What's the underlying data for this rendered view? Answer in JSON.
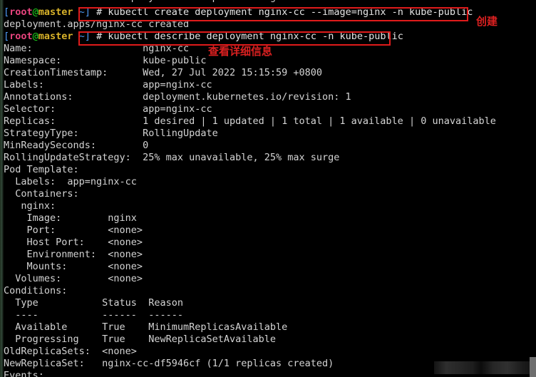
{
  "terminal": {
    "title": "root@master:~",
    "colors": {
      "background": "#000000",
      "foreground": "#d4d4d4",
      "prompt_bracket": "#4d9bf5",
      "prompt_user": "#e8447e",
      "prompt_at": "#1ee11e",
      "prompt_host": "#d8b22a",
      "annotation_red": "#d92020",
      "box_red": "#e01b1b"
    },
    "prompt": {
      "open_bracket": "[",
      "user": "root",
      "at": "@",
      "host": "master",
      "path_close": " ~]",
      "sigil": "#"
    },
    "lines": [
      {
        "type": "output",
        "text": "See 'kubectl create deployment --help' for usage."
      },
      {
        "type": "command",
        "text": "kubectl create deployment nginx-cc --image=nginx -n kube-public"
      },
      {
        "type": "output",
        "text": "deployment.apps/nginx-cc created"
      },
      {
        "type": "command",
        "text": "kubectl describe deployment nginx-cc -n kube-public"
      },
      {
        "type": "output",
        "text": "Name:                   nginx-cc"
      },
      {
        "type": "output",
        "text": "Namespace:              kube-public"
      },
      {
        "type": "output",
        "text": "CreationTimestamp:      Wed, 27 Jul 2022 15:15:59 +0800"
      },
      {
        "type": "output",
        "text": "Labels:                 app=nginx-cc"
      },
      {
        "type": "output",
        "text": "Annotations:            deployment.kubernetes.io/revision: 1"
      },
      {
        "type": "output",
        "text": "Selector:               app=nginx-cc"
      },
      {
        "type": "output",
        "text": "Replicas:               1 desired | 1 updated | 1 total | 1 available | 0 unavailable"
      },
      {
        "type": "output",
        "text": "StrategyType:           RollingUpdate"
      },
      {
        "type": "output",
        "text": "MinReadySeconds:        0"
      },
      {
        "type": "output",
        "text": "RollingUpdateStrategy:  25% max unavailable, 25% max surge"
      },
      {
        "type": "output",
        "text": "Pod Template:"
      },
      {
        "type": "output",
        "text": "  Labels:  app=nginx-cc"
      },
      {
        "type": "output",
        "text": "  Containers:"
      },
      {
        "type": "output",
        "text": "   nginx:"
      },
      {
        "type": "output",
        "text": "    Image:        nginx"
      },
      {
        "type": "output",
        "text": "    Port:         <none>"
      },
      {
        "type": "output",
        "text": "    Host Port:    <none>"
      },
      {
        "type": "output",
        "text": "    Environment:  <none>"
      },
      {
        "type": "output",
        "text": "    Mounts:       <none>"
      },
      {
        "type": "output",
        "text": "  Volumes:        <none>"
      },
      {
        "type": "output",
        "text": "Conditions:"
      },
      {
        "type": "output",
        "text": "  Type           Status  Reason"
      },
      {
        "type": "output",
        "text": "  ----           ------  ------"
      },
      {
        "type": "output",
        "text": "  Available      True    MinimumReplicasAvailable"
      },
      {
        "type": "output",
        "text": "  Progressing    True    NewReplicaSetAvailable"
      },
      {
        "type": "output",
        "text": "OldReplicaSets:  <none>"
      },
      {
        "type": "output",
        "text": "NewReplicaSet:   nginx-cc-df5946cf (1/1 replicas created)"
      },
      {
        "type": "output",
        "text": "Events:"
      }
    ],
    "annotations": [
      {
        "label": "创建",
        "meaning": "create"
      },
      {
        "label": "查看详细信息",
        "meaning": "view detailed information"
      }
    ]
  }
}
